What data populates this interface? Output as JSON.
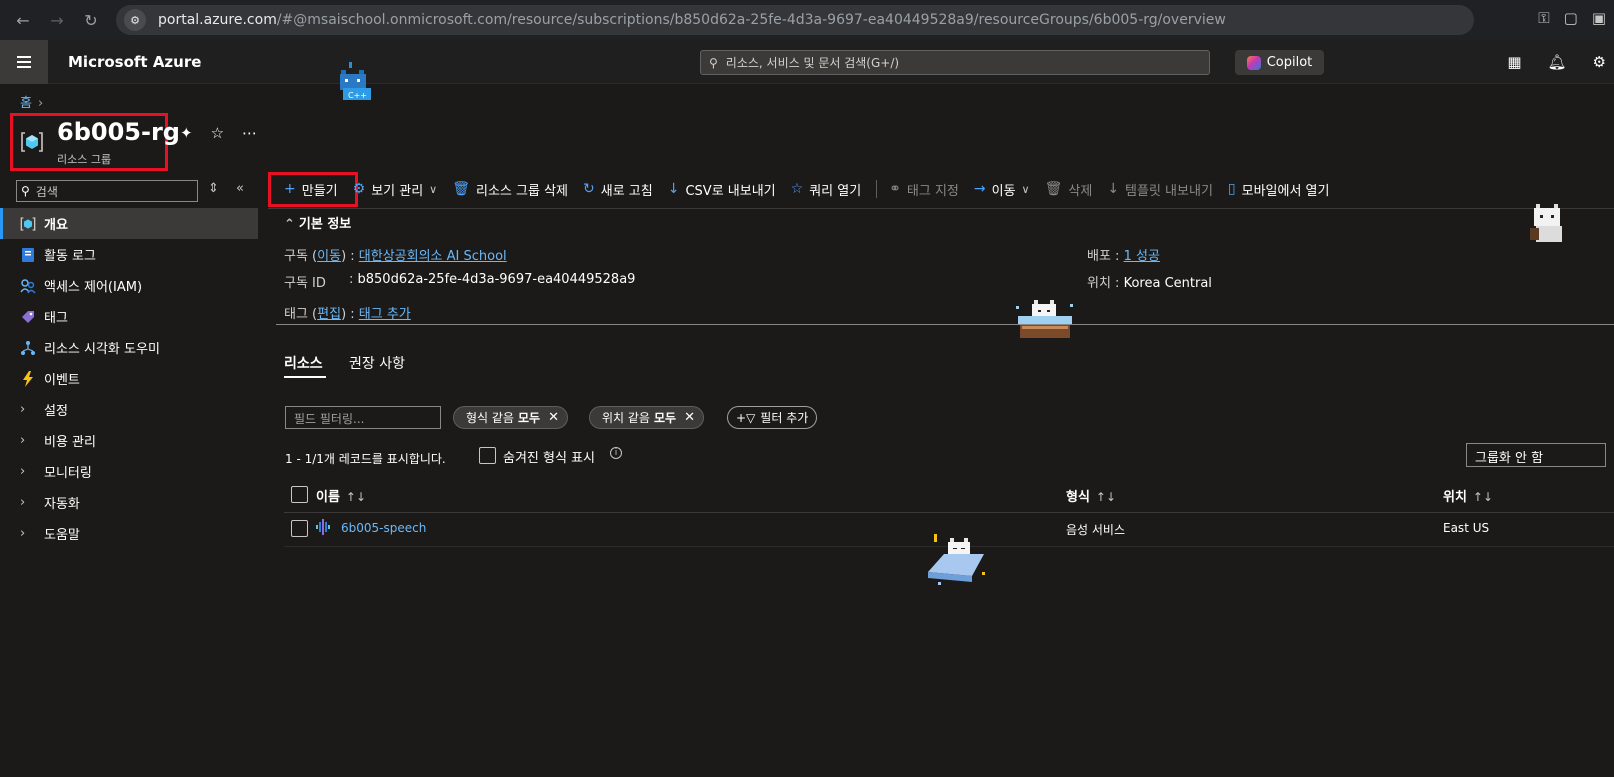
{
  "browser": {
    "url_host": "portal.azure.com",
    "url_path": "/#@msaischool.onmicrosoft.com/resource/subscriptions/b850d62a-25fe-4d3a-9697-ea40449528a9/resourceGroups/6b005-rg/overview"
  },
  "topbar": {
    "brand": "Microsoft Azure",
    "search_placeholder": "리소스, 서비스 및 문서 검색(G+/)",
    "copilot_label": "Copilot"
  },
  "breadcrumb": {
    "home": "홈"
  },
  "resource": {
    "title": "6b005-rg",
    "subtitle": "리소스 그룹"
  },
  "sidebar": {
    "search_placeholder": "검색",
    "items": [
      {
        "label": "개요",
        "icon": "resource-group-icon",
        "type": "icon"
      },
      {
        "label": "활동 로그",
        "icon": "activity-log-icon",
        "type": "icon"
      },
      {
        "label": "액세스 제어(IAM)",
        "icon": "iam-icon",
        "type": "icon"
      },
      {
        "label": "태그",
        "icon": "tag-icon",
        "type": "icon"
      },
      {
        "label": "리소스 시각화 도우미",
        "icon": "visualizer-icon",
        "type": "icon"
      },
      {
        "label": "이벤트",
        "icon": "lightning-icon",
        "type": "icon"
      },
      {
        "label": "설정",
        "type": "group"
      },
      {
        "label": "비용 관리",
        "type": "group"
      },
      {
        "label": "모니터링",
        "type": "group"
      },
      {
        "label": "자동화",
        "type": "group"
      },
      {
        "label": "도움말",
        "type": "group"
      }
    ]
  },
  "commands": {
    "create": "만들기",
    "manage_view": "보기 관리",
    "delete_rg": "리소스 그룹 삭제",
    "refresh": "새로 고침",
    "export_csv": "CSV로 내보내기",
    "open_query": "쿼리 열기",
    "assign_tags": "태그 지정",
    "move": "이동",
    "delete": "삭제",
    "export_template": "템플릿 내보내기",
    "open_mobile": "모바일에서 열기"
  },
  "essentials": {
    "header": "기본 정보",
    "subscription_label": "구독",
    "subscription_move": "이동",
    "subscription_value": "대한상공회의소 AI School",
    "subscription_id_label": "구독 ID",
    "subscription_id_value": "b850d62a-25fe-4d3a-9697-ea40449528a9",
    "tags_label": "태그",
    "tags_edit": "편집",
    "tags_add": "태그 추가",
    "deployments_label": "배포",
    "deployments_value": "1 성공",
    "location_label": "위치",
    "location_value": "Korea Central"
  },
  "tabs": {
    "resources": "리소스",
    "recommendations": "권장 사항"
  },
  "filters": {
    "placeholder": "필드 필터링...",
    "type_prefix": "형식 같음",
    "type_value": "모두",
    "location_prefix": "위치 같음",
    "location_value": "모두",
    "add_filter": "필터 추가"
  },
  "records": {
    "count_text": "1 - 1/1개 레코드를 표시합니다.",
    "show_hidden": "숨겨진 형식 표시",
    "grouping": "그룹화 안 함"
  },
  "table": {
    "columns": [
      "이름",
      "형식",
      "위치"
    ],
    "rows": [
      {
        "name": "6b005-speech",
        "type": "음성 서비스",
        "location": "East US"
      }
    ]
  },
  "colors": {
    "accent": "#2899f5",
    "link": "#6cb8f6",
    "highlight_box": "#e81123"
  }
}
